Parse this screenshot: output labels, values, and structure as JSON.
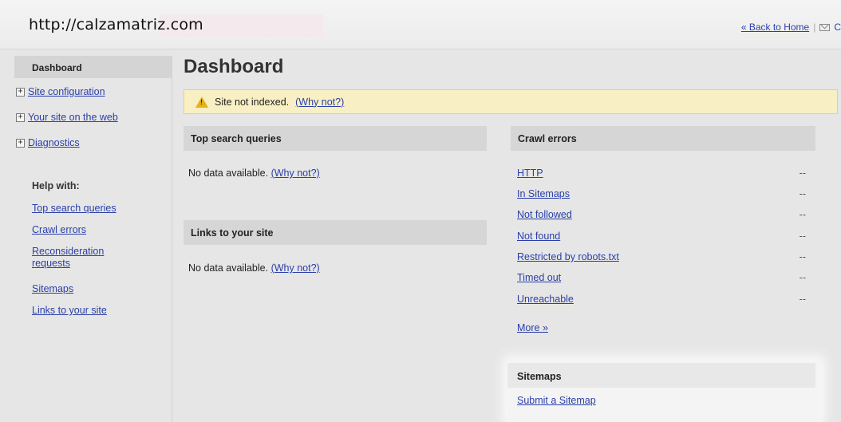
{
  "header": {
    "site_url": "http://calzamatriz.com",
    "back_link": "« Back to Home",
    "separator": "|",
    "right_cut": "C"
  },
  "sidebar": {
    "active_item": "Dashboard",
    "items": [
      {
        "label": "Site configuration"
      },
      {
        "label": "Your site on the web"
      },
      {
        "label": "Diagnostics"
      }
    ],
    "help_title": "Help with:",
    "help_links": [
      {
        "label": "Top search queries"
      },
      {
        "label": "Crawl errors"
      },
      {
        "label": "Reconsideration requests"
      },
      {
        "label": "Sitemaps"
      },
      {
        "label": "Links to your site"
      }
    ]
  },
  "main": {
    "title": "Dashboard",
    "alert": {
      "text": "Site not indexed.",
      "link": "(Why not?)"
    },
    "top_queries": {
      "title": "Top search queries",
      "text": "No data available.",
      "link": "(Why not?)"
    },
    "links": {
      "title": "Links to your site",
      "text": "No data available.",
      "link": "(Why not?)"
    },
    "crawl_errors": {
      "title": "Crawl errors",
      "rows": [
        {
          "label": "HTTP",
          "value": "--"
        },
        {
          "label": "In Sitemaps",
          "value": "--"
        },
        {
          "label": "Not followed",
          "value": "--"
        },
        {
          "label": "Not found",
          "value": "--"
        },
        {
          "label": "Restricted by robots.txt",
          "value": "--"
        },
        {
          "label": "Timed out",
          "value": "--"
        },
        {
          "label": "Unreachable",
          "value": "--"
        }
      ],
      "more": "More »"
    },
    "sitemaps": {
      "title": "Sitemaps",
      "link": "Submit a Sitemap"
    }
  },
  "colors": {
    "link": "#2a3fa8",
    "alert_bg": "#f8f0c4",
    "panel_head": "#d6d6d6",
    "warning": "#e4b21c"
  }
}
